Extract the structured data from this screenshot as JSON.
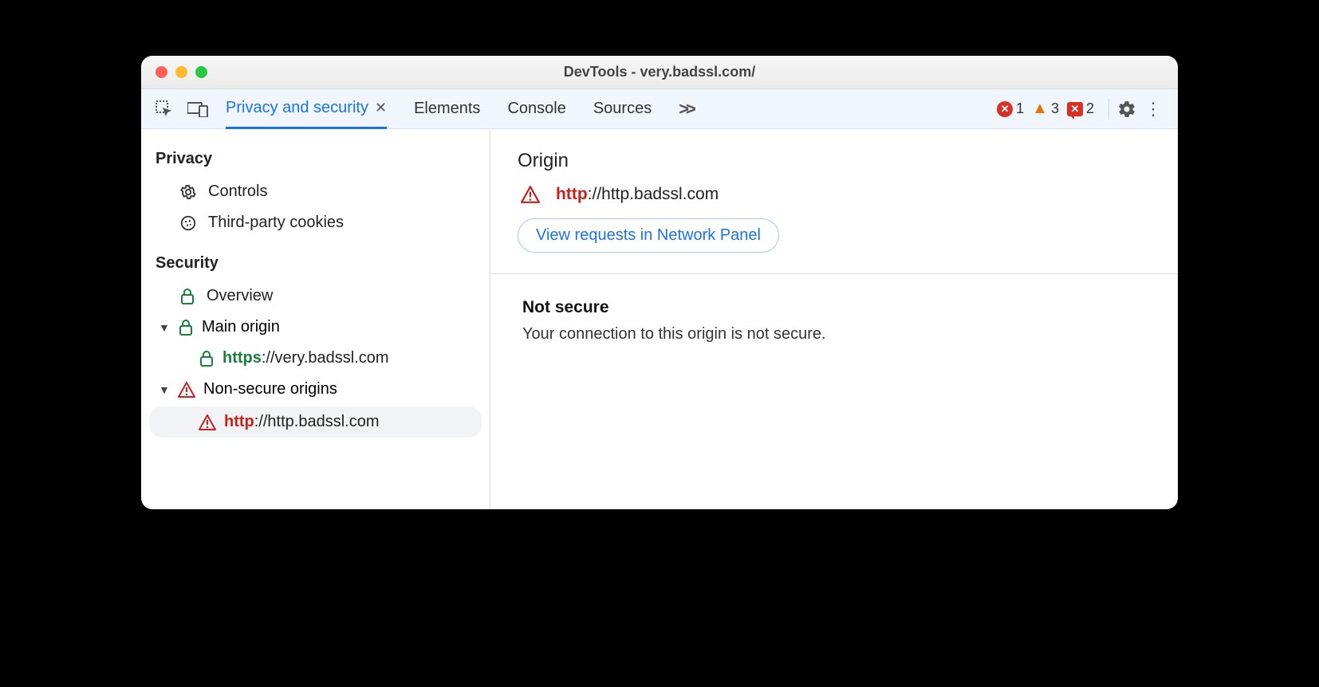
{
  "window_title": "DevTools - very.badssl.com/",
  "tabs": {
    "privacy": "Privacy and security",
    "elements": "Elements",
    "console": "Console",
    "sources": "Sources"
  },
  "badges": {
    "errors": "1",
    "warnings": "3",
    "issues": "2"
  },
  "sidebar": {
    "privacy_header": "Privacy",
    "controls": "Controls",
    "cookies": "Third-party cookies",
    "security_header": "Security",
    "overview": "Overview",
    "main_origin": "Main origin",
    "main_origin_url_scheme": "https",
    "main_origin_url_rest": "://very.badssl.com",
    "nonsecure": "Non-secure origins",
    "nonsecure_url_scheme": "http",
    "nonsecure_url_rest": "://http.badssl.com"
  },
  "main": {
    "origin_heading": "Origin",
    "origin_scheme": "http",
    "origin_rest": "://http.badssl.com",
    "view_requests": "View requests in Network Panel",
    "not_secure_h": "Not secure",
    "not_secure_p": "Your connection to this origin is not secure."
  }
}
